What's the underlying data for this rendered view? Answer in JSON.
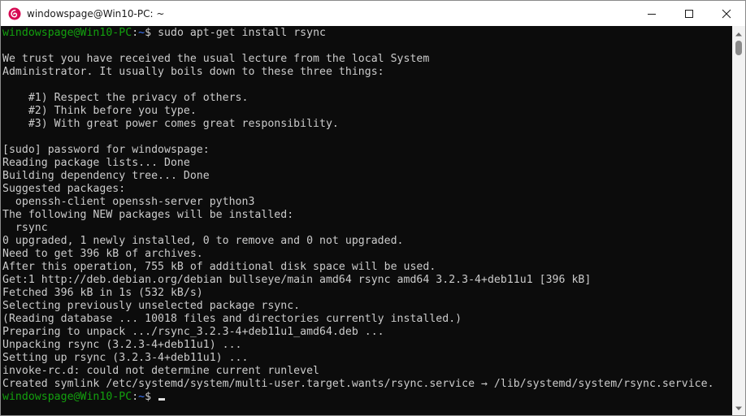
{
  "window": {
    "title": "windowspage@Win10-PC: ~",
    "app_icon": "debian-swirl-icon",
    "controls": {
      "minimize": "minimize-icon",
      "maximize": "maximize-icon",
      "close": "close-icon"
    }
  },
  "colors": {
    "terminal_bg": "#0c0c0c",
    "text": "#cccccc",
    "prompt_user": "#13a10e",
    "prompt_path": "#3b78ff",
    "icon_red": "#d70a53"
  },
  "prompt": {
    "user_host": "windowspage@Win10-PC",
    "separator": ":",
    "path": "~",
    "symbol": "$"
  },
  "command": " sudo apt-get install rsync",
  "output_lines": [
    "",
    "We trust you have received the usual lecture from the local System",
    "Administrator. It usually boils down to these three things:",
    "",
    "    #1) Respect the privacy of others.",
    "    #2) Think before you type.",
    "    #3) With great power comes great responsibility.",
    "",
    "[sudo] password for windowspage:",
    "Reading package lists... Done",
    "Building dependency tree... Done",
    "Suggested packages:",
    "  openssh-client openssh-server python3",
    "The following NEW packages will be installed:",
    "  rsync",
    "0 upgraded, 1 newly installed, 0 to remove and 0 not upgraded.",
    "Need to get 396 kB of archives.",
    "After this operation, 755 kB of additional disk space will be used.",
    "Get:1 http://deb.debian.org/debian bullseye/main amd64 rsync amd64 3.2.3-4+deb11u1 [396 kB]",
    "Fetched 396 kB in 1s (532 kB/s)",
    "Selecting previously unselected package rsync.",
    "(Reading database ... 10018 files and directories currently installed.)",
    "Preparing to unpack .../rsync_3.2.3-4+deb11u1_amd64.deb ...",
    "Unpacking rsync (3.2.3-4+deb11u1) ...",
    "Setting up rsync (3.2.3-4+deb11u1) ...",
    "invoke-rc.d: could not determine current runlevel",
    "Created symlink /etc/systemd/system/multi-user.target.wants/rsync.service → /lib/systemd/system/rsync.service."
  ],
  "scrollbar": {
    "up_icon": "scroll-up-arrow-icon",
    "down_icon": "scroll-down-arrow-icon"
  }
}
